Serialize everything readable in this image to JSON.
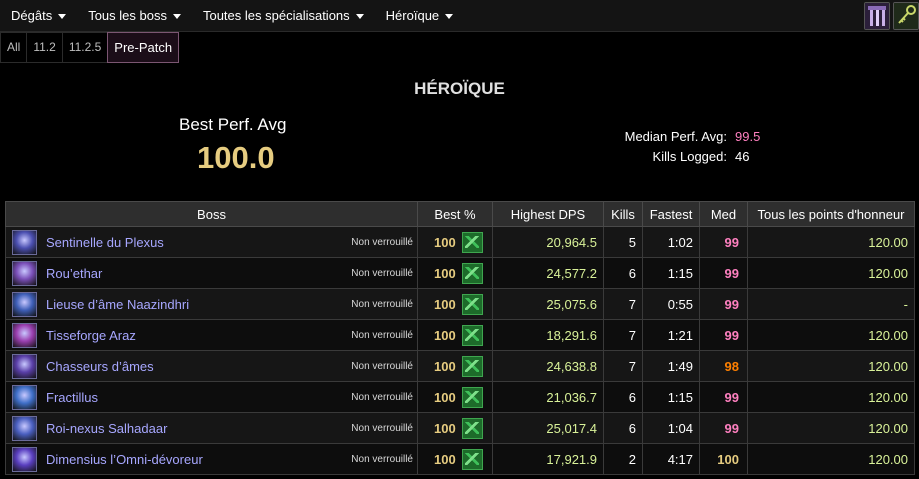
{
  "nav": {
    "dropdowns": [
      "Dégâts",
      "Tous les boss",
      "Toutes les spécialisations",
      "Héroïque"
    ],
    "icons": [
      "guild-banner-icon",
      "key-icon"
    ]
  },
  "tabs": [
    "All",
    "11.2",
    "11.2.5",
    "Pre-Patch"
  ],
  "active_tab": "Pre-Patch",
  "summary": {
    "difficulty": "HÉROÏQUE",
    "best_perf_label": "Best Perf. Avg",
    "best_perf_value": "100.0",
    "median_label": "Median Perf. Avg:",
    "median_value": "99.5",
    "kills_label": "Kills Logged:",
    "kills_value": "46"
  },
  "table": {
    "headers": [
      "Boss",
      "Best %",
      "Highest DPS",
      "Kills",
      "Fastest",
      "Med",
      "Tous les points d'honneur"
    ],
    "rows": [
      {
        "boss": "Sentinelle du Plexus",
        "status": "Non verrouillé",
        "best": "100",
        "dps": "20,964.5",
        "kills": "5",
        "fastest": "1:02",
        "med": "99",
        "points": "120.00"
      },
      {
        "boss": "Rou’ethar",
        "status": "Non verrouillé",
        "best": "100",
        "dps": "24,577.2",
        "kills": "6",
        "fastest": "1:15",
        "med": "99",
        "points": "120.00"
      },
      {
        "boss": "Lieuse d’âme Naazindhri",
        "status": "Non verrouillé",
        "best": "100",
        "dps": "25,075.6",
        "kills": "7",
        "fastest": "0:55",
        "med": "99",
        "points": "-"
      },
      {
        "boss": "Tisseforge Araz",
        "status": "Non verrouillé",
        "best": "100",
        "dps": "18,291.6",
        "kills": "7",
        "fastest": "1:21",
        "med": "99",
        "points": "120.00"
      },
      {
        "boss": "Chasseurs d’âmes",
        "status": "Non verrouillé",
        "best": "100",
        "dps": "24,638.8",
        "kills": "7",
        "fastest": "1:49",
        "med": "98",
        "points": "120.00"
      },
      {
        "boss": "Fractillus",
        "status": "Non verrouillé",
        "best": "100",
        "dps": "21,036.7",
        "kills": "6",
        "fastest": "1:15",
        "med": "99",
        "points": "120.00"
      },
      {
        "boss": "Roi-nexus Salhadaar",
        "status": "Non verrouillé",
        "best": "100",
        "dps": "25,017.4",
        "kills": "6",
        "fastest": "1:04",
        "med": "99",
        "points": "120.00"
      },
      {
        "boss": "Dimensius l’Omni-dévoreur",
        "status": "Non verrouillé",
        "best": "100",
        "dps": "17,921.9",
        "kills": "2",
        "fastest": "4:17",
        "med": "100",
        "points": "120.00"
      }
    ]
  },
  "colors": {
    "best_perf": "#e6cc80",
    "median": "#ff80c0",
    "med_98": "#ff8000",
    "boss_name": "#a7a7ff",
    "dps": "#d9f299"
  }
}
